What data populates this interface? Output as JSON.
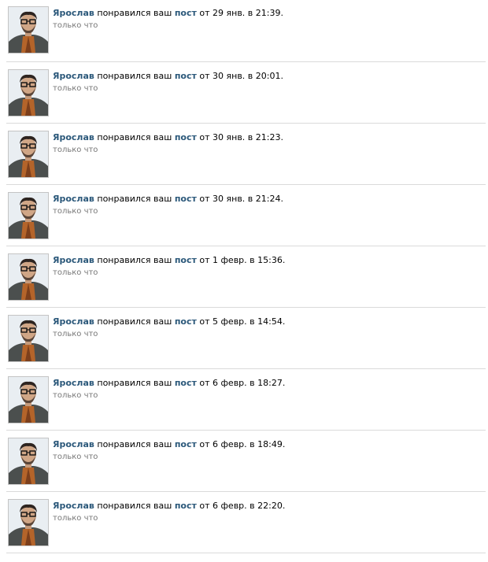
{
  "notifications": [
    {
      "user": "Ярослав",
      "action": "понравился ваш",
      "object": "пост",
      "date_text": "от 29 янв. в 21:39.",
      "time": "только что"
    },
    {
      "user": "Ярослав",
      "action": "понравился ваш",
      "object": "пост",
      "date_text": "от 30 янв. в 20:01.",
      "time": "только что"
    },
    {
      "user": "Ярослав",
      "action": "понравился ваш",
      "object": "пост",
      "date_text": "от 30 янв. в 21:23.",
      "time": "только что"
    },
    {
      "user": "Ярослав",
      "action": "понравился ваш",
      "object": "пост",
      "date_text": "от 30 янв. в 21:24.",
      "time": "только что"
    },
    {
      "user": "Ярослав",
      "action": "понравился ваш",
      "object": "пост",
      "date_text": "от 1 февр. в 15:36.",
      "time": "только что"
    },
    {
      "user": "Ярослав",
      "action": "понравился ваш",
      "object": "пост",
      "date_text": "от 5 февр. в 14:54.",
      "time": "только что"
    },
    {
      "user": "Ярослав",
      "action": "понравился ваш",
      "object": "пост",
      "date_text": "от 6 февр. в 18:27.",
      "time": "только что"
    },
    {
      "user": "Ярослав",
      "action": "понравился ваш",
      "object": "пост",
      "date_text": "от 6 февр. в 18:49.",
      "time": "только что"
    },
    {
      "user": "Ярослав",
      "action": "понравился ваш",
      "object": "пост",
      "date_text": "от 6 февр. в 22:20.",
      "time": "только что"
    }
  ],
  "colors": {
    "link": "#2b587a",
    "meta": "#777777",
    "divider": "#dadada"
  }
}
